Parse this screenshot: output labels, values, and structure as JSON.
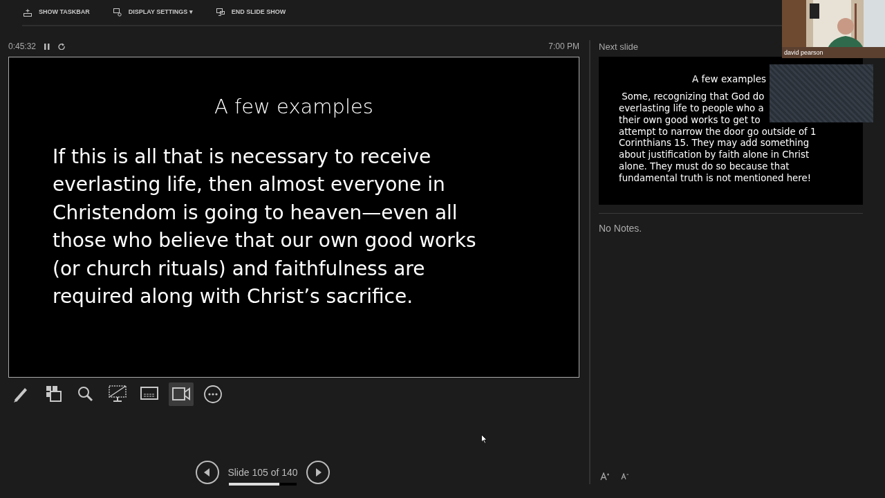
{
  "toolbar": [
    {
      "kind": "taskbar",
      "label": "SHOW TASKBAR"
    },
    {
      "kind": "display",
      "label": "DISPLAY SETTINGS ▾"
    },
    {
      "kind": "end",
      "label": "END SLIDE SHOW"
    }
  ],
  "timer": {
    "elapsed": "0:45:32",
    "clock": "7:00 PM"
  },
  "current_slide": {
    "title": "A few examples",
    "body_lines": [
      "If this is all that is necessary to receive",
      "everlasting life, then almost everyone in",
      "Christendom is going to heaven—even all",
      "those who believe that our own good works",
      "(or church rituals) and faithfulness are",
      "required along with Christ’s sacrifice."
    ]
  },
  "tools": [
    {
      "kind": "pen",
      "selected": false
    },
    {
      "kind": "slides",
      "selected": false
    },
    {
      "kind": "zoom",
      "selected": false
    },
    {
      "kind": "black",
      "selected": false
    },
    {
      "kind": "subtitles",
      "selected": false
    },
    {
      "kind": "camera",
      "selected": true
    },
    {
      "kind": "more",
      "selected": false
    }
  ],
  "navigation": {
    "label": "Slide 105 of 140",
    "level": 0.75
  },
  "next_slide": {
    "heading": "Next slide",
    "title": "A few examples",
    "body_lines": [
      " Some, recognizing that God do",
      "everlasting life to people who a",
      "their own good works to get to",
      "attempt to narrow the door go outside of 1",
      "Corinthians 15. They may add something",
      "about justification by faith alone in Christ",
      "alone. They must do so because that",
      "fundamental truth is not mentioned here!"
    ]
  },
  "notes": "No Notes.",
  "webcam": {
    "kind": "picture",
    "name": "david pearson"
  }
}
